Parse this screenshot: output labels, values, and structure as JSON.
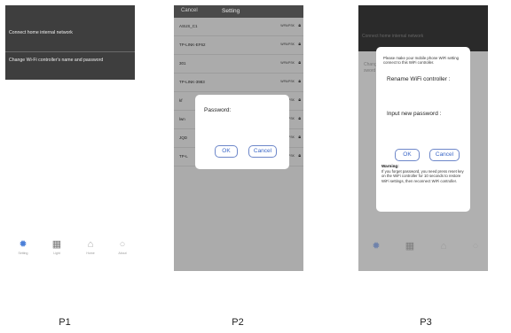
{
  "p1": {
    "menu": [
      {
        "label": "Connect home internal network"
      },
      {
        "label": "Change Wi-Fi controller's name and password"
      }
    ],
    "tabs": [
      {
        "label": "Setting",
        "icon": "gear-icon"
      },
      {
        "label": "Light",
        "icon": "grid-icon"
      },
      {
        "label": "Home",
        "icon": "house-icon"
      },
      {
        "label": "About",
        "icon": "circle-icon"
      }
    ]
  },
  "p2": {
    "header": {
      "cancel": "Cancel",
      "title": "Setting"
    },
    "networks": [
      {
        "name": "ASUS_C1",
        "signal": "WPA/PSK"
      },
      {
        "name": "TP-LINK-EF62",
        "signal": "WPA/PSK"
      },
      {
        "name": "301",
        "signal": "WPA/PSK"
      },
      {
        "name": "TP-LINK-3983",
        "signal": "WPA/PSK"
      },
      {
        "name": "kf",
        "signal": "WPA/PSK"
      },
      {
        "name": "lwn",
        "signal": "WPA/PSK"
      },
      {
        "name": "JQD",
        "signal": "WPA/PSK"
      },
      {
        "name": "TP-L",
        "signal": "WPA/PSK"
      }
    ],
    "dialog": {
      "label": "Password:",
      "ok": "OK",
      "cancel": "Cancel"
    }
  },
  "p3": {
    "header_text": "Connect home internal network",
    "bg_fragment": "Chang\nsword",
    "dialog": {
      "note": "Please make your mobile phone WiFi setting connect to this WiFi controller.",
      "rename_label": "Rename WiFi controller :",
      "password_label": "Input new password :",
      "ok": "OK",
      "cancel": "Cancel",
      "warning_title": "Warning:",
      "warning_text": "If you forget password, you need press reset key on the WiFi controller for 10 seconds to restore WiFi settings, then reconnect WiFi controller."
    }
  },
  "captions": {
    "p1": "P1",
    "p2": "P2",
    "p3": "P3"
  },
  "colors": {
    "accent": "#3a66c7",
    "dark_header": "#3e3e3e",
    "tab_active": "#4a7fd8"
  }
}
